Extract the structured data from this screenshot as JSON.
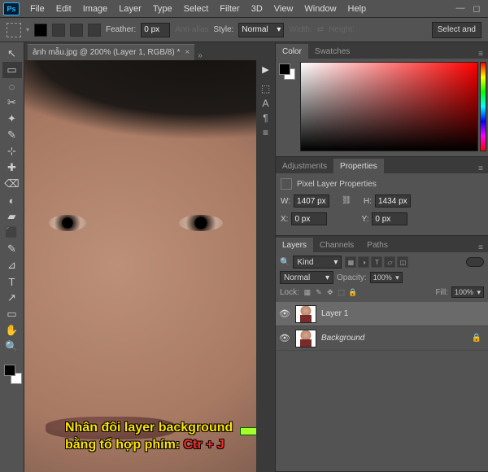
{
  "menu": {
    "items": [
      "File",
      "Edit",
      "Image",
      "Layer",
      "Type",
      "Select",
      "Filter",
      "3D",
      "View",
      "Window",
      "Help"
    ]
  },
  "opt": {
    "feather_label": "Feather:",
    "feather_value": "0 px",
    "aa_label": "Anti-alias",
    "style_label": "Style:",
    "style_value": "Normal",
    "width_label": "Width:",
    "height_label": "Height:",
    "swap": "⇄",
    "right_btn": "Select and"
  },
  "doc": {
    "tab": "ảnh mẫu.jpg @ 200% (Layer 1, RGB/8) *"
  },
  "tools": [
    "↖",
    "▭",
    "◌",
    "✂",
    "✦",
    "✎",
    "⊹",
    "✚",
    "⌫",
    "◐",
    "▰",
    "⬛",
    "✎",
    "⊿",
    "T",
    "↗",
    "▭",
    "✋",
    "🔍"
  ],
  "dock": [
    "▶",
    "⬚",
    "A",
    "¶",
    "≡"
  ],
  "color_panel": {
    "tabs": [
      "Color",
      "Swatches"
    ]
  },
  "adj_panel": {
    "tabs": [
      "Adjustments",
      "Properties"
    ],
    "title": "Pixel Layer Properties",
    "w_label": "W:",
    "w_value": "1407 px",
    "h_label": "H:",
    "h_value": "1434 px",
    "x_label": "X:",
    "x_value": "0 px",
    "y_label": "Y:",
    "y_value": "0 px"
  },
  "layers_panel": {
    "tabs": [
      "Layers",
      "Channels",
      "Paths"
    ],
    "kind": "Kind",
    "blend": "Normal",
    "opacity_label": "Opacity:",
    "opacity_value": "100%",
    "lock_label": "Lock:",
    "fill_label": "Fill:",
    "fill_value": "100%",
    "items": [
      {
        "name": "Layer 1",
        "bg": false,
        "active": true,
        "locked": false
      },
      {
        "name": "Background",
        "bg": true,
        "active": false,
        "locked": true
      }
    ]
  },
  "annotation": {
    "line1": "Nhân đôi layer background",
    "line2_a": "bằng tổ hợp phím: ",
    "line2_b": "Ctr + J"
  }
}
